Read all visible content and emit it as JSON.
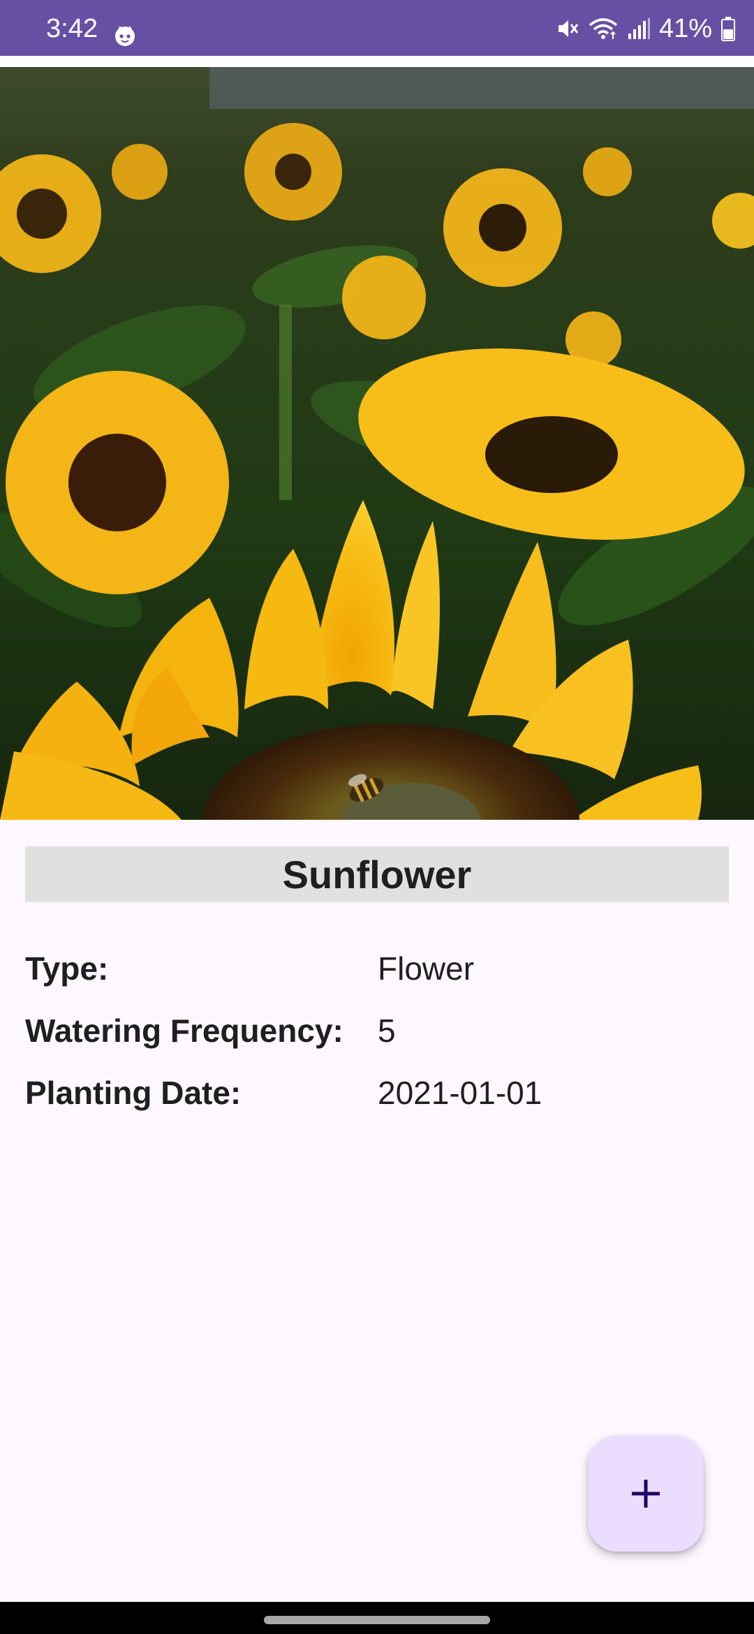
{
  "status_bar": {
    "time": "3:42",
    "battery_percent": "41%",
    "icons": [
      "notification-face-icon",
      "mute-icon",
      "wifi-icon",
      "signal-icon",
      "battery-icon"
    ],
    "color": "#6750a4"
  },
  "plant": {
    "name": "Sunflower",
    "image": "sunflower-photo"
  },
  "details": {
    "type_label": "Type:",
    "type_value": "Flower",
    "watering_label": "Watering Frequency:",
    "watering_value": "5",
    "planting_label": "Planting Date:",
    "planting_value": "2021-01-01"
  },
  "fab": {
    "icon": "plus-icon",
    "color": "#eaddff"
  },
  "colors": {
    "background": "#fdf7ff",
    "title_bar": "#e0e0e0"
  }
}
